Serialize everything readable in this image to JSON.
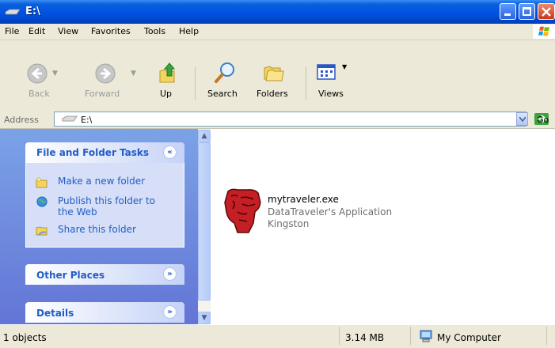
{
  "window": {
    "title": "E:\\"
  },
  "menu": [
    "File",
    "Edit",
    "View",
    "Favorites",
    "Tools",
    "Help"
  ],
  "toolbar": {
    "back": "Back",
    "forward": "Forward",
    "up": "Up",
    "search": "Search",
    "folders": "Folders",
    "views": "Views"
  },
  "address": {
    "label": "Address",
    "value": "E:\\",
    "go": "Go"
  },
  "taskpane": {
    "file_folder_tasks": {
      "title": "File and Folder Tasks",
      "links": [
        "Make a new folder",
        "Publish this folder to",
        "the Web",
        "Share this folder"
      ]
    },
    "other_places": {
      "title": "Other Places"
    },
    "details": {
      "title": "Details"
    }
  },
  "file": {
    "name": "mytraveler.exe",
    "description": "DataTraveler's Application",
    "company": "Kingston"
  },
  "status": {
    "objects": "1 objects",
    "size": "3.14 MB",
    "zone": "My Computer"
  },
  "colors": {
    "title_bar": "#0054e3",
    "task_link": "#215dc6",
    "taskpane_bg": "#7ba2e7"
  },
  "icons": [
    "drive-icon",
    "back-icon",
    "forward-icon",
    "up-folder-icon",
    "search-icon",
    "folders-icon",
    "views-icon",
    "new-folder-icon",
    "publish-web-icon",
    "share-folder-icon",
    "kingston-exe-icon",
    "my-computer-icon"
  ]
}
